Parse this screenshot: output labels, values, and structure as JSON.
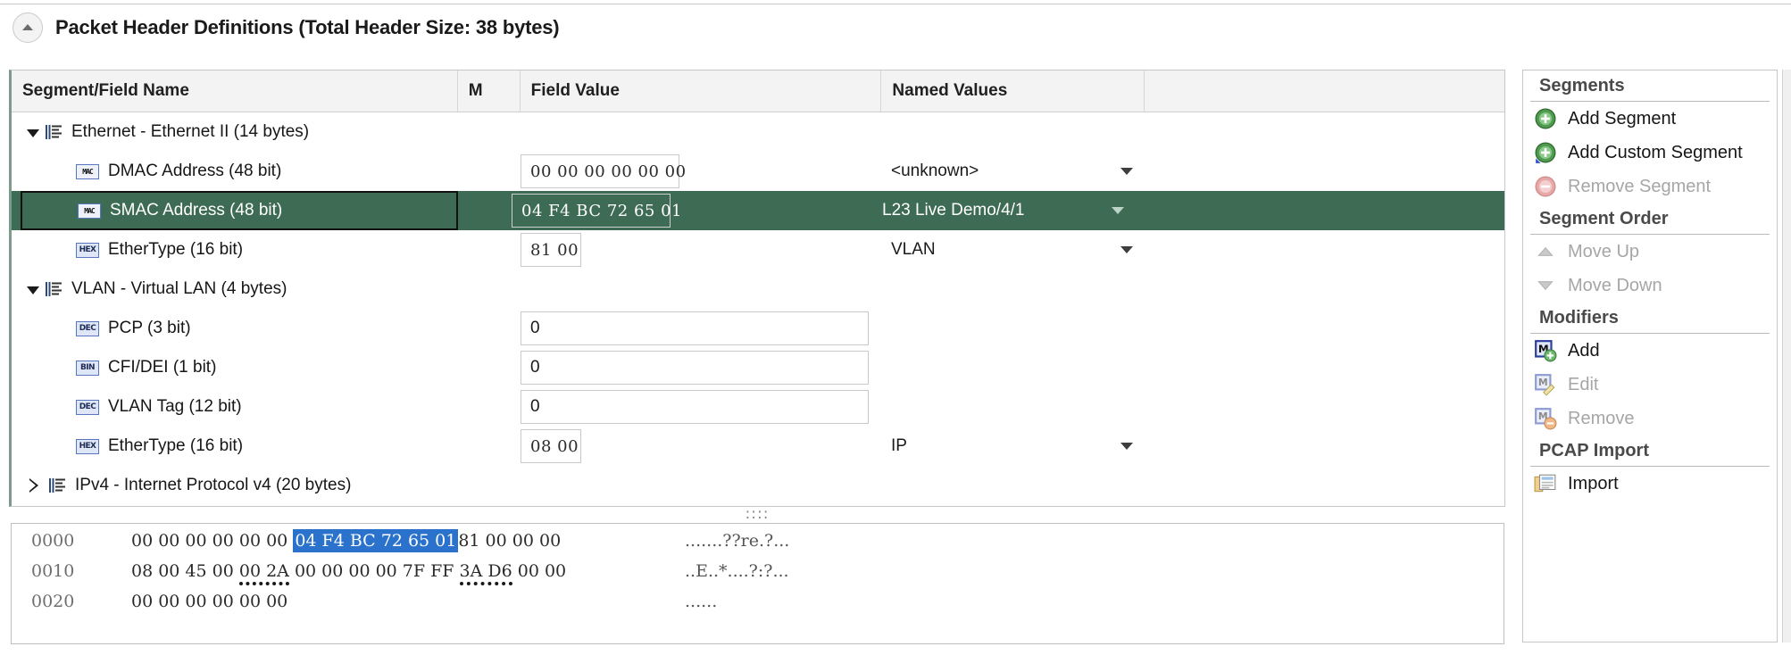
{
  "titlebar": {
    "expander_icon": "chevron-up-icon",
    "title": "Packet Header Definitions (Total Header Size: 38 bytes)"
  },
  "grid": {
    "columns": [
      "Segment/Field Name",
      "M",
      "Field Value",
      "Named Values",
      ""
    ],
    "rows": [
      {
        "kind": "segment",
        "expanded": true,
        "icon": "segment-icon",
        "label": "Ethernet - Ethernet II (14 bytes)",
        "value": "",
        "named": "",
        "has_caret": false,
        "selected": false
      },
      {
        "kind": "field",
        "icon": "mac-type-icon",
        "badge": "MAC",
        "label": "DMAC Address (48 bit)",
        "value": "00 00 00 00 00 00",
        "named": "<unknown>",
        "has_caret": true,
        "selected": false
      },
      {
        "kind": "field",
        "icon": "mac-type-icon",
        "badge": "MAC",
        "label": "SMAC Address (48 bit)",
        "value": "04 F4 BC 72 65 01",
        "named": "L23 Live Demo/4/1",
        "has_caret": true,
        "selected": true
      },
      {
        "kind": "field",
        "icon": "hex-type-icon",
        "badge": "HEX",
        "label": "EtherType (16 bit)",
        "value": "81 00",
        "named": "VLAN",
        "has_caret": true,
        "selected": false
      },
      {
        "kind": "segment",
        "expanded": true,
        "icon": "segment-icon",
        "label": "VLAN - Virtual LAN (4 bytes)",
        "value": "",
        "named": "",
        "has_caret": false,
        "selected": false
      },
      {
        "kind": "field",
        "icon": "dec-type-icon",
        "badge": "DEC",
        "label": "PCP (3 bit)",
        "value": "0",
        "named": "",
        "has_caret": false,
        "selected": false
      },
      {
        "kind": "field",
        "icon": "bin-type-icon",
        "badge": "BIN",
        "label": "CFI/DEI (1 bit)",
        "value": "0",
        "named": "",
        "has_caret": false,
        "selected": false
      },
      {
        "kind": "field",
        "icon": "dec-type-icon",
        "badge": "DEC",
        "label": "VLAN Tag (12 bit)",
        "value": "0",
        "named": "",
        "has_caret": false,
        "selected": false
      },
      {
        "kind": "field",
        "icon": "hex-type-icon",
        "badge": "HEX",
        "label": "EtherType (16 bit)",
        "value": "08 00",
        "named": "IP",
        "has_caret": true,
        "selected": false
      },
      {
        "kind": "segment",
        "expanded": false,
        "icon": "segment-icon",
        "label": "IPv4 - Internet Protocol v4 (20 bytes)",
        "value": "",
        "named": "",
        "has_caret": false,
        "selected": false
      }
    ]
  },
  "splitter": {
    "grip": "::::"
  },
  "hexdump": {
    "lines": [
      {
        "offset": "0000",
        "pre": "00 00 00 00 00 00 ",
        "highlight": "04 F4 BC 72 65 01",
        "post": "81 00 00 00",
        "ascii": ".......??re.?..."
      },
      {
        "offset": "0010",
        "seg_a": "08 00 45 00 ",
        "seg_b": "00 2A",
        "seg_c": " 00 00 00 00 7F FF ",
        "seg_d": "3A D6",
        "seg_e": " 00 00",
        "ascii": "..E..*....?:?..."
      },
      {
        "offset": "0020",
        "plain": "00 00 00 00 00 00",
        "ascii": "......"
      }
    ]
  },
  "sidebar": {
    "groups": [
      {
        "title": "Segments",
        "items": [
          {
            "label": "Add Segment",
            "icon": "add-circle-green-icon",
            "disabled": false
          },
          {
            "label": "Add Custom Segment",
            "icon": "add-circle-green-icon",
            "disabled": false
          },
          {
            "label": "Remove Segment",
            "icon": "remove-circle-red-icon",
            "disabled": true
          }
        ]
      },
      {
        "title": "Segment Order",
        "items": [
          {
            "label": "Move Up",
            "icon": "arrow-up-icon",
            "disabled": true
          },
          {
            "label": "Move Down",
            "icon": "arrow-down-icon",
            "disabled": true
          }
        ]
      },
      {
        "title": "Modifiers",
        "items": [
          {
            "label": "Add",
            "icon": "modifier-add-icon",
            "disabled": false
          },
          {
            "label": "Edit",
            "icon": "modifier-edit-icon",
            "disabled": true
          },
          {
            "label": "Remove",
            "icon": "modifier-remove-icon",
            "disabled": true
          }
        ]
      },
      {
        "title": "PCAP Import",
        "items": [
          {
            "label": "Import",
            "icon": "pcap-import-icon",
            "disabled": false
          }
        ]
      }
    ]
  },
  "colors": {
    "selection_green": "#3d6b54",
    "hex_highlight_blue": "#2a72cc",
    "header_grey": "#f3f3f3",
    "accent_left_border": "#7d9b8c"
  }
}
